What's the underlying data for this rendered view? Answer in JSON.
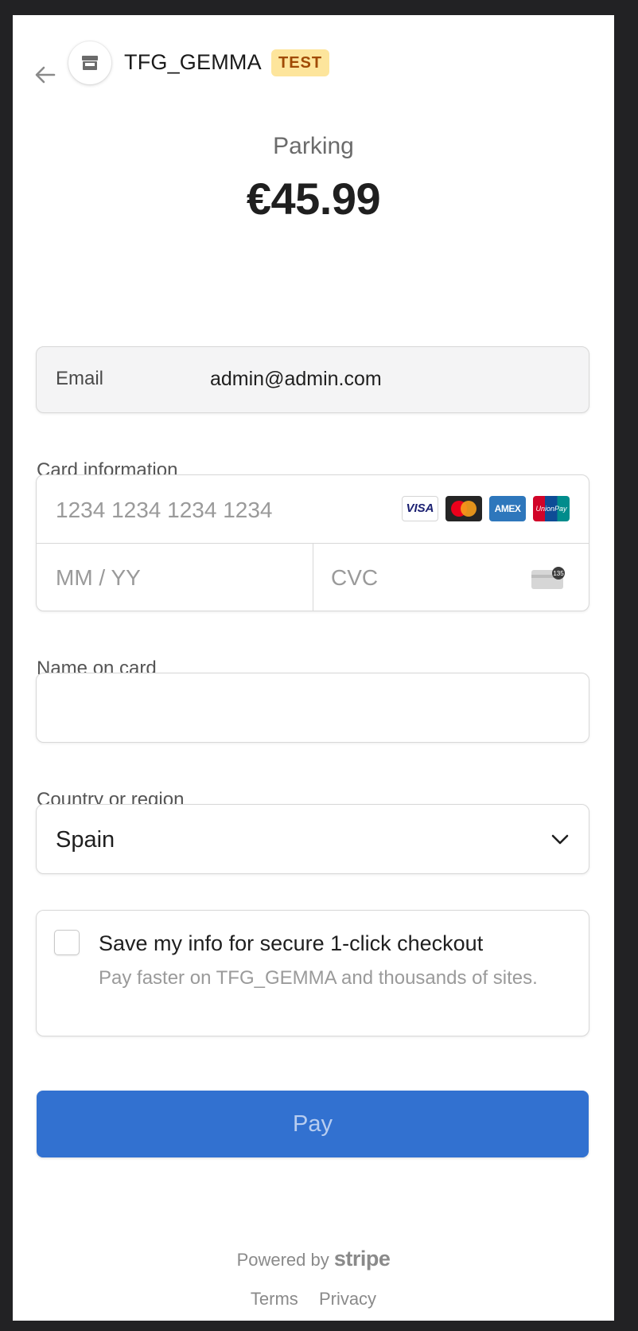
{
  "header": {
    "merchant_name": "TFG_GEMMA",
    "test_badge": "TEST",
    "back_icon": "arrow-left-icon",
    "store_icon": "storefront-icon"
  },
  "product": {
    "name": "Parking",
    "price": "€45.99"
  },
  "email": {
    "label": "Email",
    "value": "admin@admin.com"
  },
  "card": {
    "label": "Card information",
    "number_placeholder": "1234 1234 1234 1234",
    "expiry_placeholder": "MM / YY",
    "cvc_placeholder": "CVC",
    "brands": [
      "VISA",
      "Mastercard",
      "AMEX",
      "UnionPay"
    ],
    "cvc_hint": "135"
  },
  "name_on_card": {
    "label": "Name on card",
    "value": ""
  },
  "country": {
    "label": "Country or region",
    "selected": "Spain"
  },
  "save_info": {
    "checked": false,
    "title": "Save my info for secure 1-click checkout",
    "description": "Pay faster on TFG_GEMMA and thousands of sites."
  },
  "pay_button": {
    "label": "Pay"
  },
  "footer": {
    "powered_by": "Powered by",
    "stripe": "stripe",
    "terms": "Terms",
    "privacy": "Privacy"
  },
  "colors": {
    "background": "#222224",
    "accent": "#3271d0",
    "test_badge_bg": "#fde59c",
    "test_badge_text": "#a04a04"
  }
}
